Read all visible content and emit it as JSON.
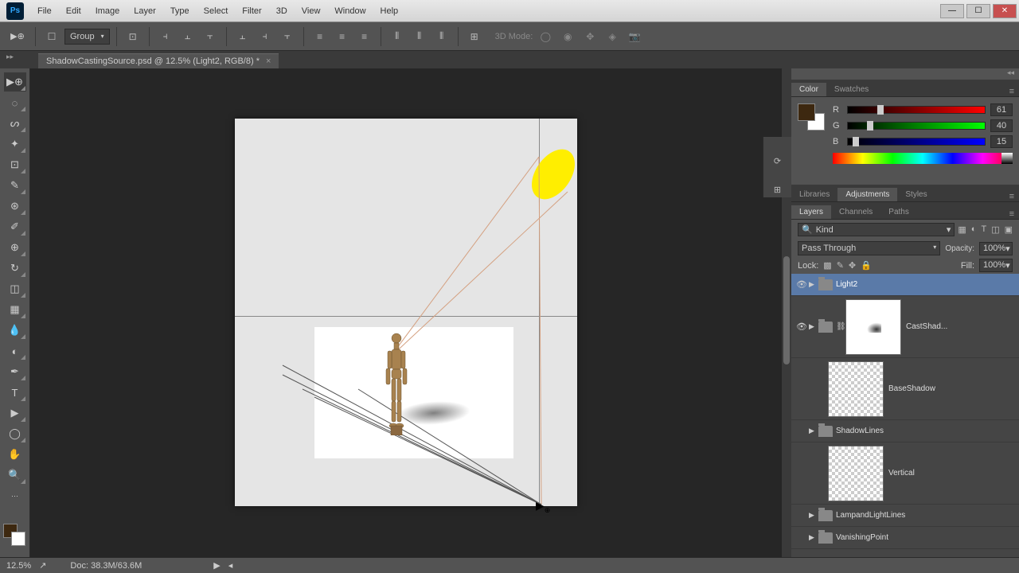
{
  "menu": {
    "items": [
      "File",
      "Edit",
      "Image",
      "Layer",
      "Type",
      "Select",
      "Filter",
      "3D",
      "View",
      "Window",
      "Help"
    ]
  },
  "logo": "Ps",
  "options": {
    "group": "Group",
    "mode3d": "3D Mode:"
  },
  "tab": {
    "title": "ShadowCastingSource.psd @ 12.5% (Light2, RGB/8) *"
  },
  "status": {
    "zoom": "12.5%",
    "docsize": "Doc: 38.3M/63.6M"
  },
  "colorPanel": {
    "tabs": [
      "Color",
      "Swatches"
    ],
    "r": {
      "label": "R",
      "val": "61",
      "pos": 24
    },
    "g": {
      "label": "G",
      "val": "40",
      "pos": 16
    },
    "b": {
      "label": "B",
      "val": "15",
      "pos": 6
    }
  },
  "adjPanel": {
    "tabs": [
      "Libraries",
      "Adjustments",
      "Styles"
    ]
  },
  "layersPanel": {
    "tabs": [
      "Layers",
      "Channels",
      "Paths"
    ],
    "kindIcon": "🔍",
    "kind": "Kind",
    "blend": "Pass Through",
    "opacityLabel": "Opacity:",
    "opacity": "100%",
    "lockLabel": "Lock:",
    "fillLabel": "Fill:",
    "fill": "100%",
    "layers": [
      {
        "name": "Light2",
        "type": "group",
        "selected": true,
        "visible": true
      },
      {
        "name": "CastShad...",
        "type": "mask",
        "visible": true,
        "tall": true
      },
      {
        "name": "BaseShadow",
        "type": "pixel",
        "visible": false,
        "tall": true
      },
      {
        "name": "ShadowLines",
        "type": "group",
        "visible": false
      },
      {
        "name": "Vertical",
        "type": "pixel",
        "visible": false,
        "tall": true
      },
      {
        "name": "LampandLightLines",
        "type": "group",
        "visible": false
      },
      {
        "name": "VanishingPoint",
        "type": "group",
        "visible": false
      }
    ]
  }
}
